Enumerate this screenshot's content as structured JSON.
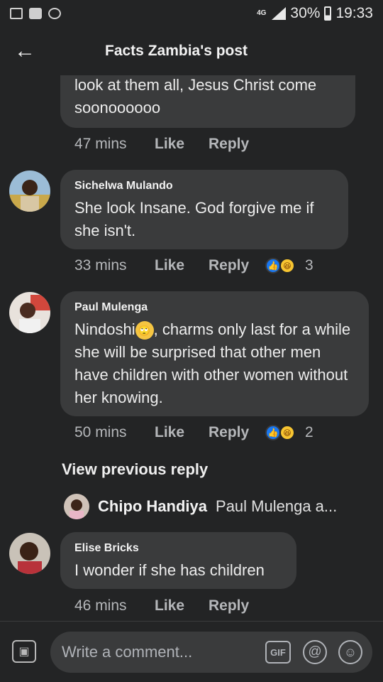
{
  "status_bar": {
    "network": "4G",
    "battery": "30%",
    "time": "19:33"
  },
  "header": {
    "title": "Facts Zambia's post"
  },
  "comments": [
    {
      "author": "",
      "text": "look at them all, Jesus Christ come soonoooooo",
      "time": "47 mins",
      "like_label": "Like",
      "reply_label": "Reply",
      "reaction_count": ""
    },
    {
      "author": "Sichelwa Mulando",
      "text": "She look Insane. God forgive me if she isn't.",
      "time": "33 mins",
      "like_label": "Like",
      "reply_label": "Reply",
      "reaction_count": "3"
    },
    {
      "author": "Paul Mulenga",
      "text_before_emoji": "Nindoshi",
      "text_after_emoji": ", charms only last for a while she will be surprised that other men have children with other women without her knowing.",
      "time": "50 mins",
      "like_label": "Like",
      "reply_label": "Reply",
      "reaction_count": "2"
    },
    {
      "author": "Elise Bricks",
      "text": "I wonder if she has children",
      "time": "46 mins",
      "like_label": "Like",
      "reply_label": "Reply"
    }
  ],
  "view_previous": "View previous reply",
  "reply_preview": {
    "name": "Chipo Handiya",
    "text": "Paul Mulenga a..."
  },
  "composer": {
    "placeholder": "Write a comment...",
    "gif_label": "GIF",
    "at_label": "@"
  },
  "colors": {
    "background": "#232425",
    "bubble": "#3a3b3c",
    "like_reaction": "#1877f2",
    "haha_reaction": "#f7c531"
  }
}
